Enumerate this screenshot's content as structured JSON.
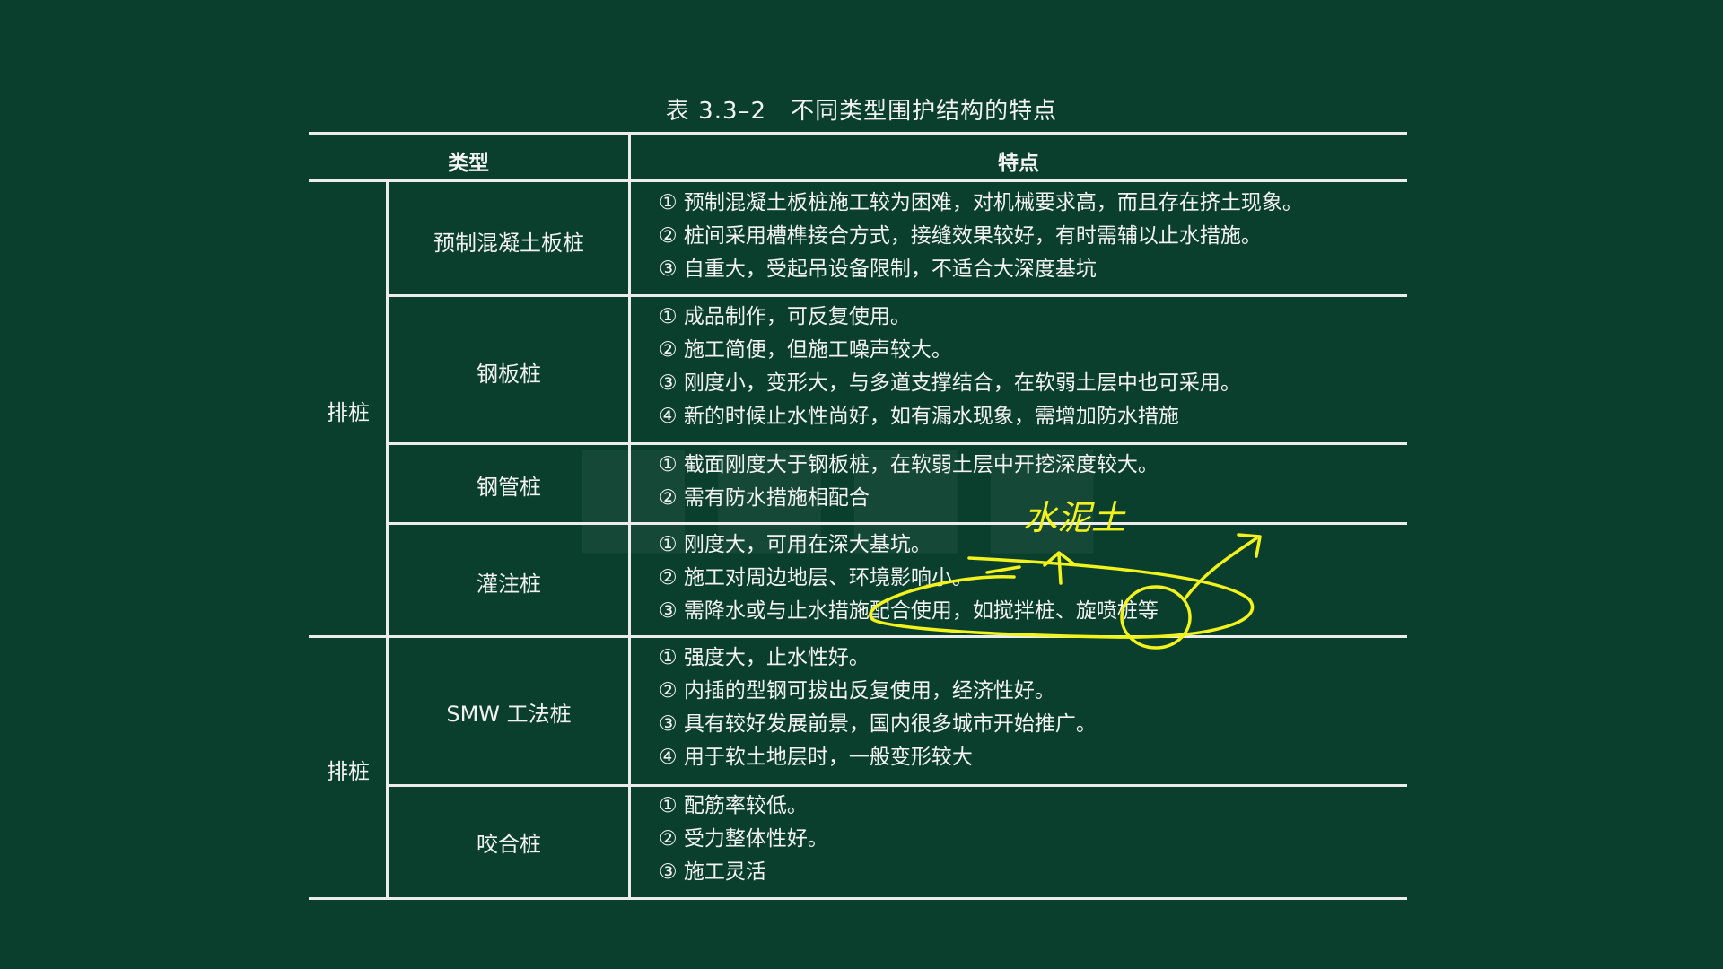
{
  "table": {
    "title": "表 3.3–2　不同类型围护结构的特点",
    "header": {
      "type": "类型",
      "features": "特点"
    },
    "groups": [
      {
        "label": "排桩"
      },
      {
        "label": "排桩"
      }
    ],
    "rows": [
      {
        "type": "预制混凝土板桩",
        "features": [
          "① 预制混凝土板桩施工较为困难，对机械要求高，而且存在挤土现象。",
          "② 桩间采用槽榫接合方式，接缝效果较好，有时需辅以止水措施。",
          "③ 自重大，受起吊设备限制，不适合大深度基坑"
        ]
      },
      {
        "type": "钢板桩",
        "features": [
          "① 成品制作，可反复使用。",
          "② 施工简便，但施工噪声较大。",
          "③ 刚度小，变形大，与多道支撑结合，在软弱土层中也可采用。",
          "④ 新的时候止水性尚好，如有漏水现象，需增加防水措施"
        ]
      },
      {
        "type": "钢管桩",
        "features": [
          "① 截面刚度大于钢板桩，在软弱土层中开挖深度较大。",
          "② 需有防水措施相配合"
        ]
      },
      {
        "type": "灌注桩",
        "features": [
          "① 刚度大，可用在深大基坑。",
          "② 施工对周边地层、环境影响小。",
          "③ 需降水或与止水措施配合使用，如搅拌桩、旋喷桩等"
        ]
      },
      {
        "type": "SMW 工法桩",
        "features": [
          "① 强度大，止水性好。",
          "② 内插的型钢可拔出反复使用，经济性好。",
          "③ 具有较好发展前景，国内很多城市开始推广。",
          "④ 用于软土地层时，一般变形较大"
        ]
      },
      {
        "type": "咬合桩",
        "features": [
          "① 配筋率较低。",
          "② 受力整体性好。",
          "③ 施工灵活"
        ]
      }
    ]
  },
  "annotation": {
    "handwritten_text": "水泥土",
    "ink_color": "#f2f21c"
  },
  "colors": {
    "background": "#0a3f2e",
    "text": "#f2f2f2",
    "rule": "#ececec"
  }
}
